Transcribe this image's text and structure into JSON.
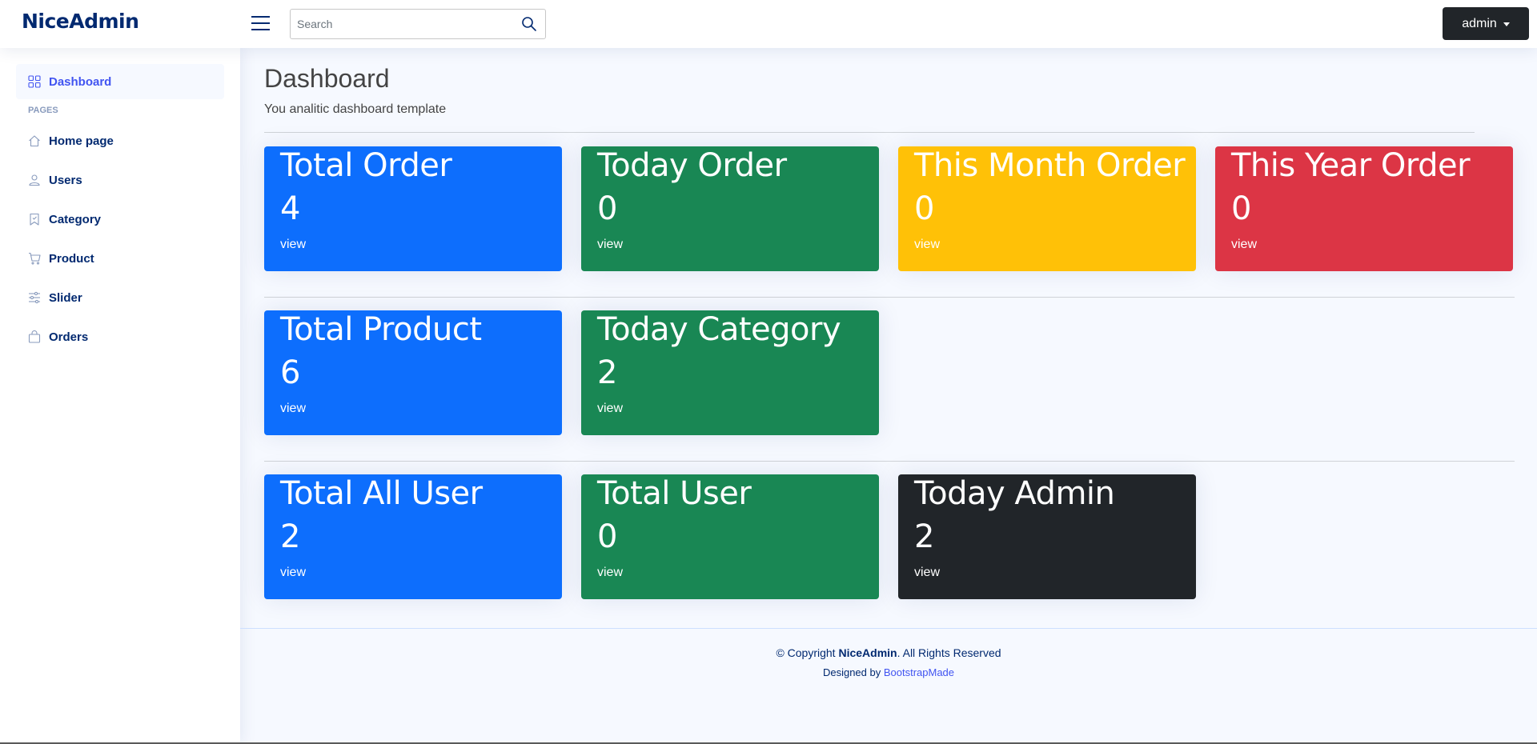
{
  "header": {
    "logo": "NiceAdmin",
    "search_placeholder": "Search",
    "user_label": "admin"
  },
  "sidebar": {
    "items": [
      {
        "label": "Dashboard",
        "icon": "grid-icon"
      },
      {
        "label": "Home page",
        "icon": "house-icon"
      },
      {
        "label": "Users",
        "icon": "person-icon"
      },
      {
        "label": "Category",
        "icon": "bookmark-icon"
      },
      {
        "label": "Product",
        "icon": "cart-icon"
      },
      {
        "label": "Slider",
        "icon": "sliders-icon"
      },
      {
        "label": "Orders",
        "icon": "bag-icon"
      }
    ],
    "heading": "PAGES"
  },
  "page": {
    "title": "Dashboard",
    "subtitle": "You analitic dashboard template"
  },
  "cards": [
    {
      "title": "Total Order",
      "value": "4",
      "link": "view",
      "color": "#0d6efd"
    },
    {
      "title": "Today Order",
      "value": "0",
      "link": "view",
      "color": "#198754"
    },
    {
      "title": "This Month Order",
      "value": "0",
      "link": "view",
      "color": "#ffc107"
    },
    {
      "title": "This Year Order",
      "value": "0",
      "link": "view",
      "color": "#dc3545"
    },
    {
      "title": "Total Product",
      "value": "6",
      "link": "view",
      "color": "#0d6efd"
    },
    {
      "title": "Today Category",
      "value": "2",
      "link": "view",
      "color": "#198754"
    },
    {
      "title": "Total All User",
      "value": "2",
      "link": "view",
      "color": "#0d6efd"
    },
    {
      "title": "Total User",
      "value": "0",
      "link": "view",
      "color": "#198754"
    },
    {
      "title": "Today Admin",
      "value": "2",
      "link": "view",
      "color": "#212529"
    }
  ],
  "footer": {
    "copy_prefix": "© Copyright ",
    "brand": "NiceAdmin",
    "copy_suffix": ". All Rights Reserved",
    "designed_by": "Designed by ",
    "designer": "BootstrapMade"
  }
}
